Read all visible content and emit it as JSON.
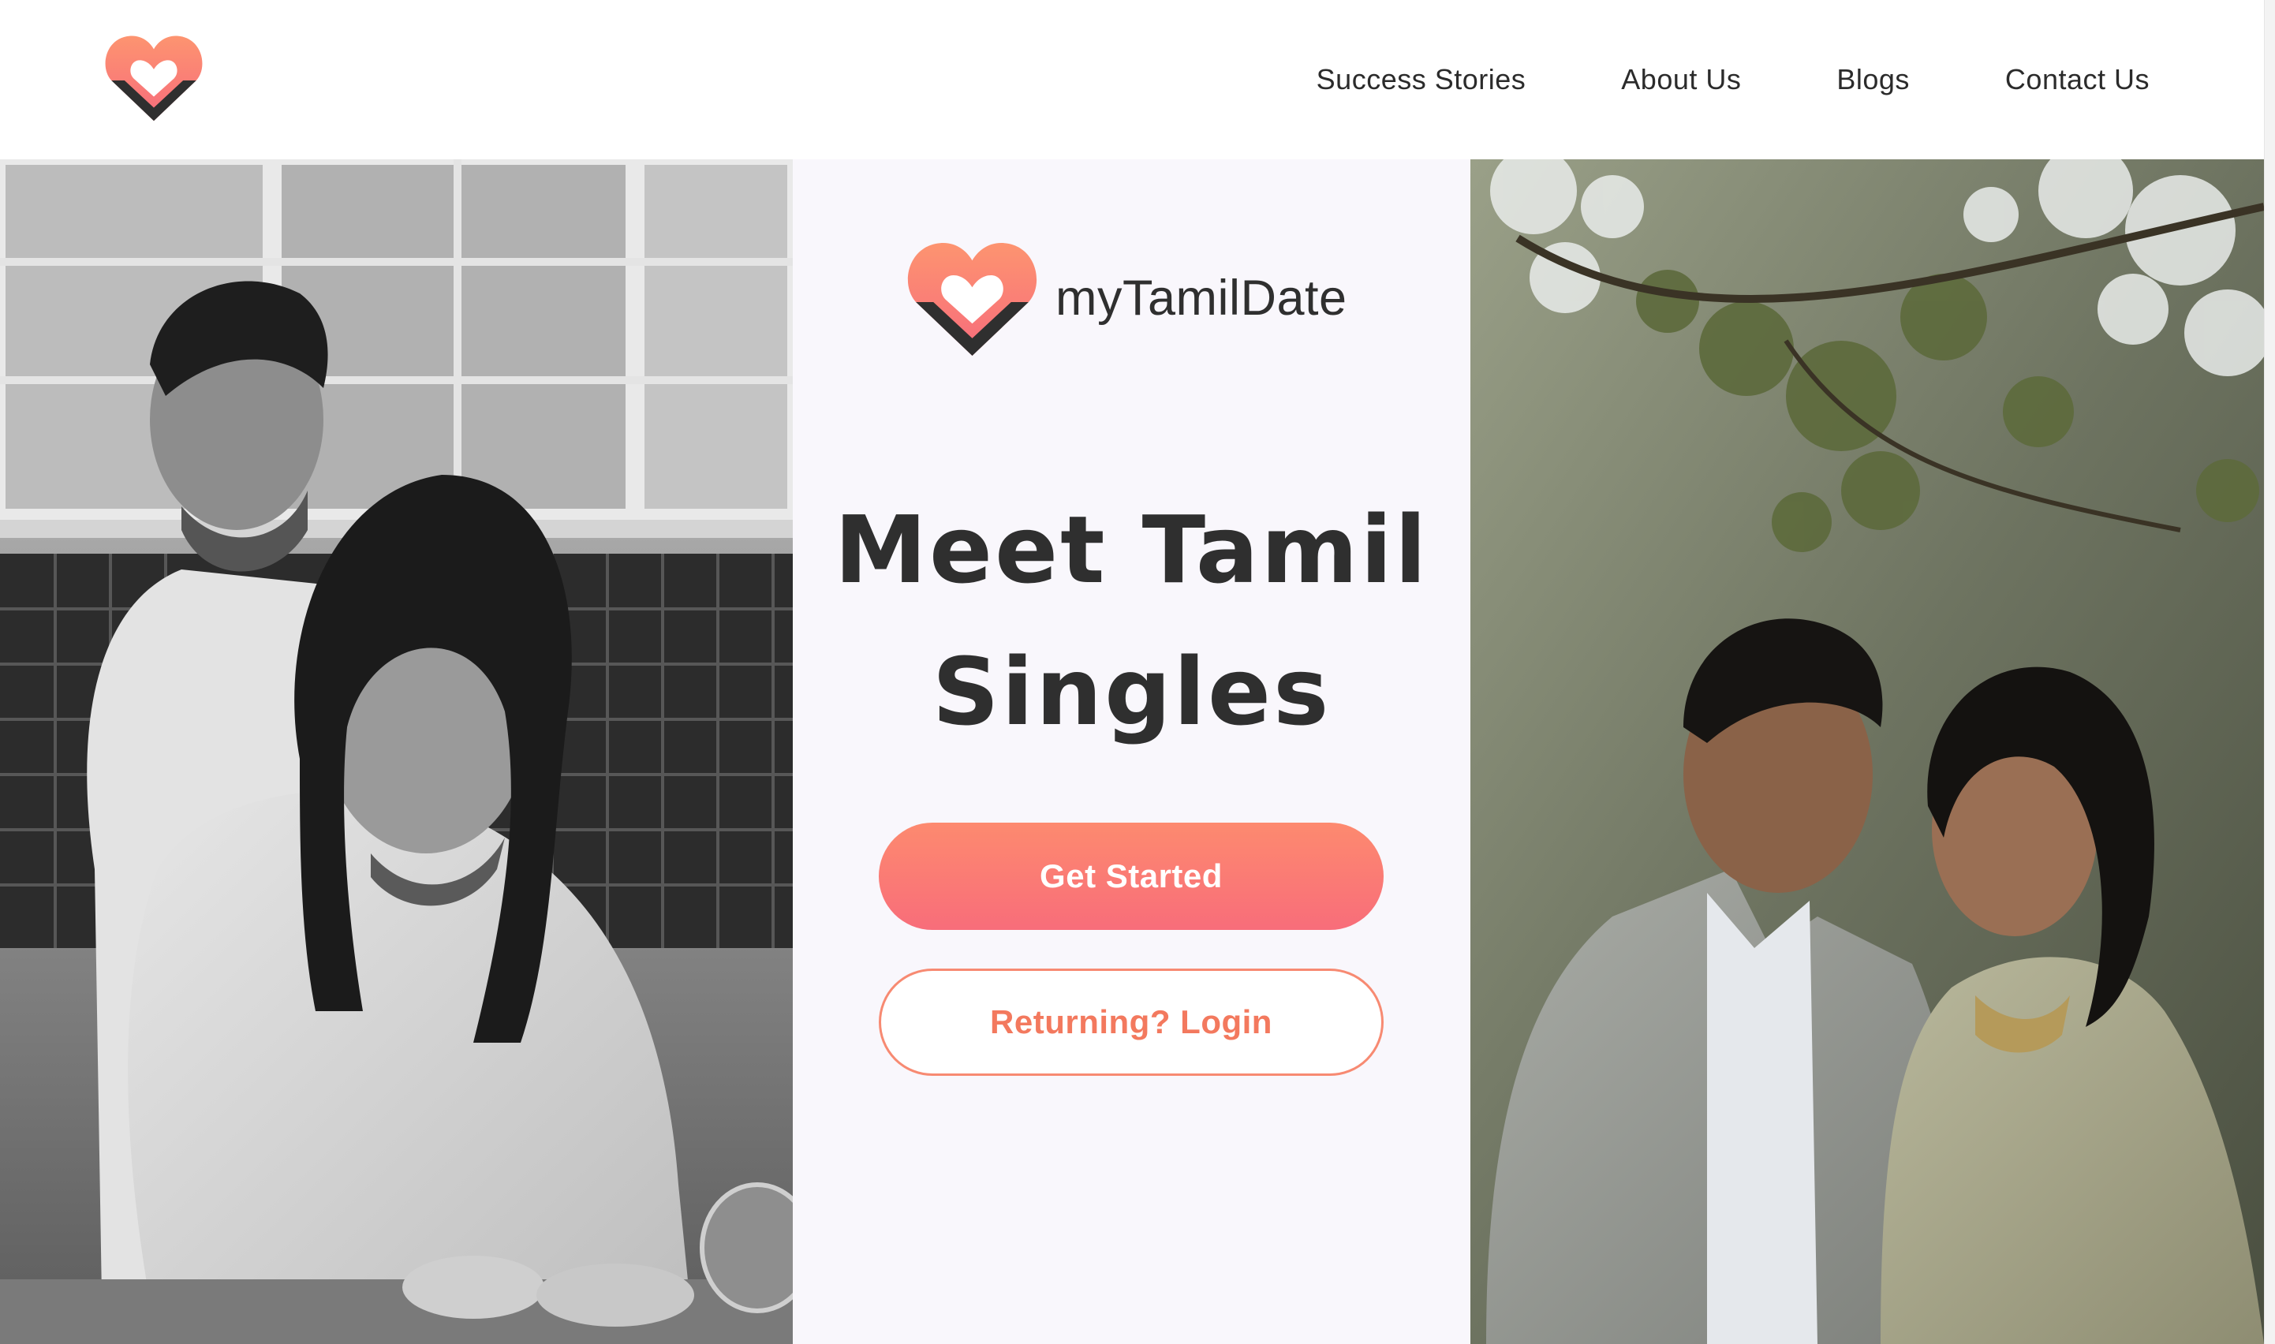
{
  "header": {
    "logo_icon": "heart-logo-icon",
    "nav": [
      {
        "label": "Success Stories"
      },
      {
        "label": "About Us"
      },
      {
        "label": "Blogs"
      },
      {
        "label": "Contact Us"
      }
    ]
  },
  "hero": {
    "brand_name": "myTamilDate",
    "headline_line1": "Meet Tamil",
    "headline_line2": "Singles",
    "primary_button": "Get Started",
    "secondary_button": "Returning? Login"
  },
  "colors": {
    "accent_start": "#fd8a6f",
    "accent_end": "#f86d7a",
    "logo_dark": "#2f2f2f",
    "text_dark": "#2f2f2f",
    "center_bg": "#f9f7fc"
  },
  "images": {
    "left": "couple-cooking-photo",
    "right": "couple-outdoors-photo"
  }
}
